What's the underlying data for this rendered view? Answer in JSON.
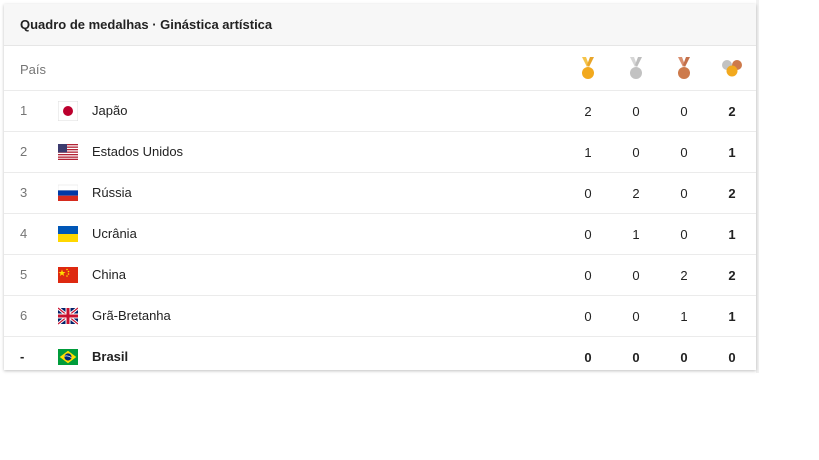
{
  "header": {
    "title": "Quadro de medalhas · Ginástica artística"
  },
  "columns": {
    "country": "País",
    "medal_icons": [
      "gold-medal-icon",
      "silver-medal-icon",
      "bronze-medal-icon",
      "total-medals-icon"
    ]
  },
  "colors": {
    "gold": "#f2a91e",
    "silver": "#c2c2c2",
    "bronze": "#cd7a4b"
  },
  "rows": [
    {
      "rank": "1",
      "country": "Japão",
      "flag": "japan",
      "gold": "2",
      "silver": "0",
      "bronze": "0",
      "total": "2"
    },
    {
      "rank": "2",
      "country": "Estados Unidos",
      "flag": "usa",
      "gold": "1",
      "silver": "0",
      "bronze": "0",
      "total": "1"
    },
    {
      "rank": "3",
      "country": "Rússia",
      "flag": "russia",
      "gold": "0",
      "silver": "2",
      "bronze": "0",
      "total": "2"
    },
    {
      "rank": "4",
      "country": "Ucrânia",
      "flag": "ukraine",
      "gold": "0",
      "silver": "1",
      "bronze": "0",
      "total": "1"
    },
    {
      "rank": "5",
      "country": "China",
      "flag": "china",
      "gold": "0",
      "silver": "0",
      "bronze": "2",
      "total": "2"
    },
    {
      "rank": "6",
      "country": "Grã-Bretanha",
      "flag": "great-britain",
      "gold": "0",
      "silver": "0",
      "bronze": "1",
      "total": "1"
    },
    {
      "rank": "-",
      "country": "Brasil",
      "flag": "brazil",
      "gold": "0",
      "silver": "0",
      "bronze": "0",
      "total": "0"
    }
  ]
}
